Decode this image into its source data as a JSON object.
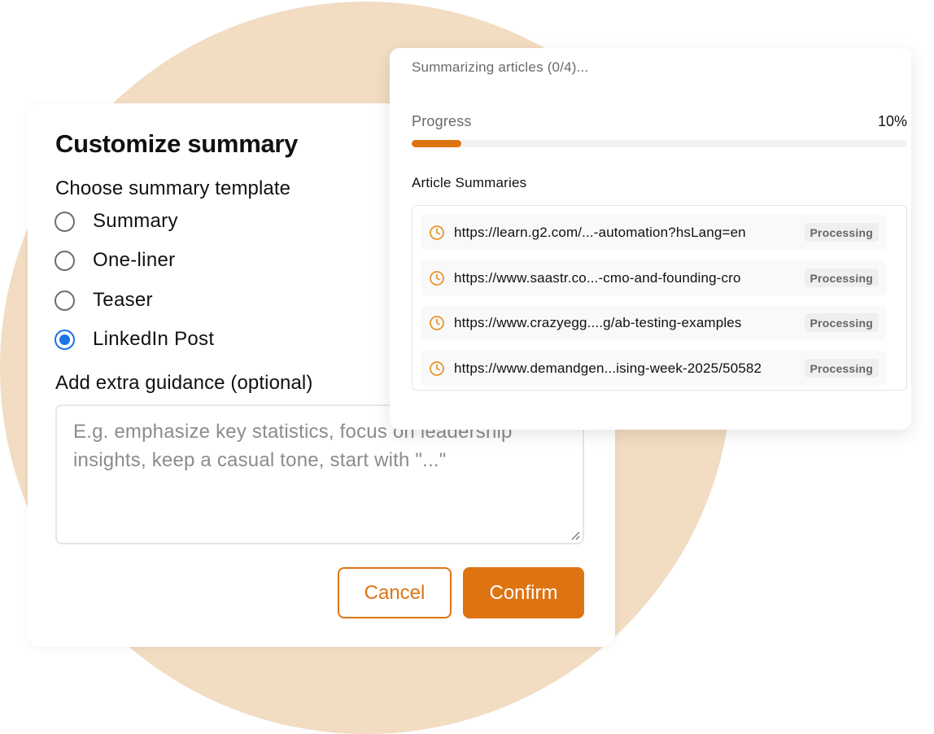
{
  "colors": {
    "accent": "#dd7411",
    "background_circle": "#f2dcc2",
    "radio_selected": "#1a73e8"
  },
  "customize": {
    "title": "Customize summary",
    "template_label": "Choose summary template",
    "options": [
      {
        "label": "Summary",
        "selected": false
      },
      {
        "label": "One-liner",
        "selected": false
      },
      {
        "label": "Teaser",
        "selected": false
      },
      {
        "label": "LinkedIn Post",
        "selected": true
      }
    ],
    "guidance_label": "Add extra guidance (optional)",
    "guidance_placeholder": "E.g. emphasize key statistics, focus on leadership insights, keep a casual tone, start with \"...\"",
    "guidance_value": "",
    "cancel_label": "Cancel",
    "confirm_label": "Confirm"
  },
  "progress": {
    "status": "Summarizing articles (0/4)...",
    "label": "Progress",
    "percent_text": "10%",
    "percent": 10,
    "summaries_heading": "Article Summaries",
    "articles": [
      {
        "url": "https://learn.g2.com/...-automation?hsLang=en",
        "status": "Processing",
        "icon": "clock-icon"
      },
      {
        "url": "https://www.saastr.co...-cmo-and-founding-cro",
        "status": "Processing",
        "icon": "clock-icon"
      },
      {
        "url": "https://www.crazyegg....g/ab-testing-examples",
        "status": "Processing",
        "icon": "clock-icon"
      },
      {
        "url": "https://www.demandgen...ising-week-2025/50582",
        "status": "Processing",
        "icon": "clock-icon"
      }
    ]
  }
}
